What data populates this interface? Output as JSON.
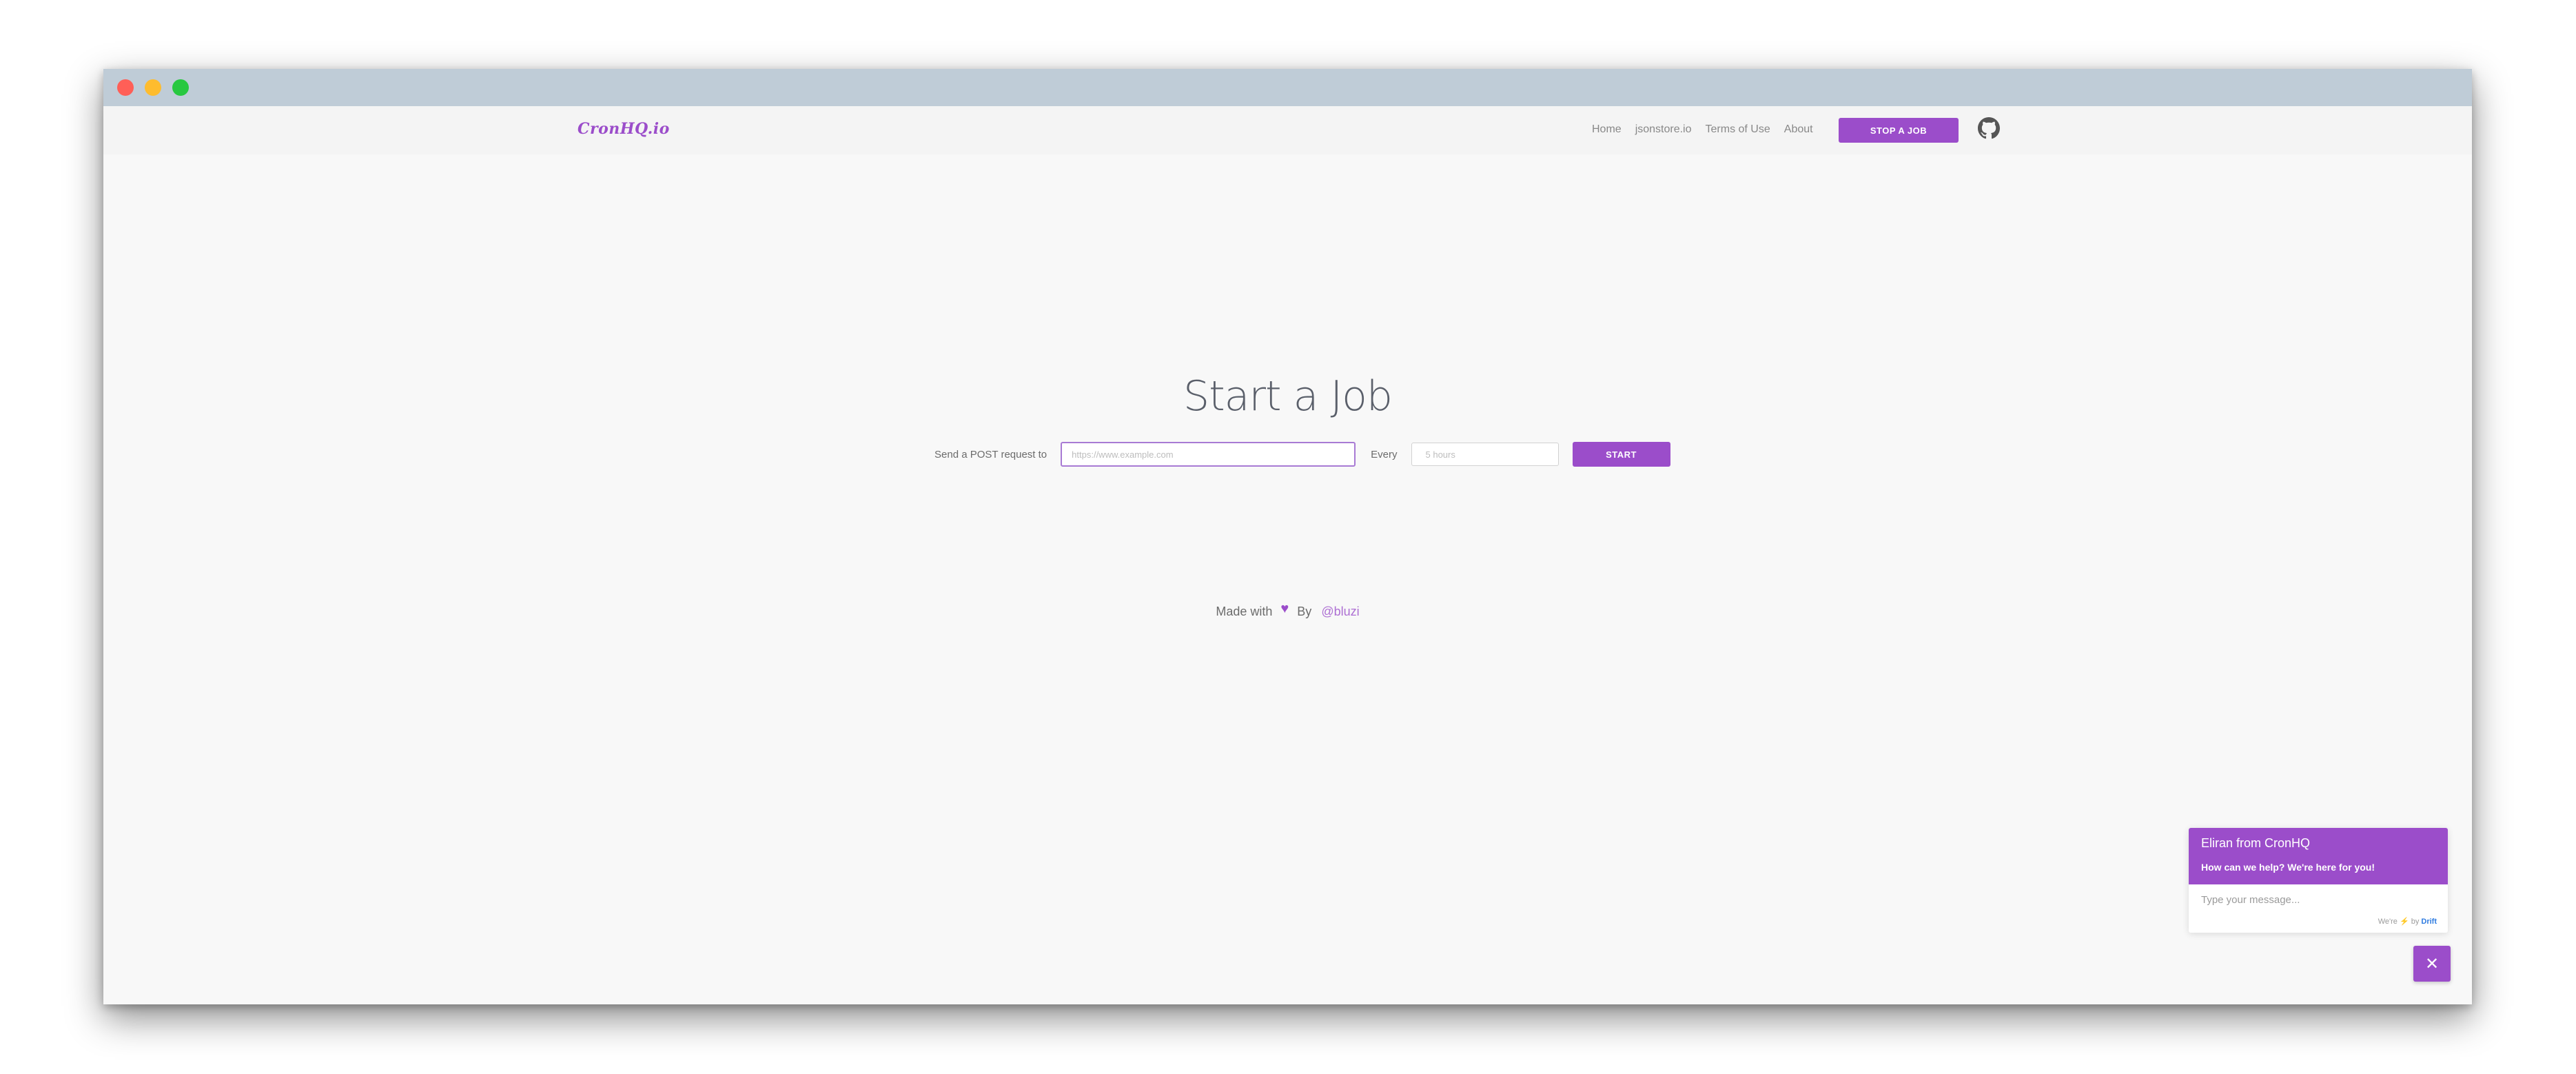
{
  "app": {
    "brand": "CronHQ.io"
  },
  "nav": {
    "links": [
      "Home",
      "jsonstore.io",
      "Terms of Use",
      "About"
    ],
    "stop_button": "STOP A JOB",
    "github_icon": "github-icon"
  },
  "main": {
    "title": "Start a Job",
    "send_label": "Send a POST request to",
    "url_placeholder": "https://www.example.com",
    "every_label": "Every",
    "interval_placeholder": "5 hours",
    "start_button": "START"
  },
  "footer": {
    "made_with": "Made with",
    "heart_icon": "heart-icon",
    "by": "By",
    "handle": "@bluzi"
  },
  "chat": {
    "agent_name": "Eliran from CronHQ",
    "greeting": "How can we help? We're here for you!",
    "input_placeholder": "Type your message...",
    "powered_prefix": "We're",
    "powered_by": "by",
    "powered_brand": "Drift",
    "close_icon": "close-icon"
  },
  "colors": {
    "accent": "#9b4dca",
    "titlebar": "#bfccd7",
    "background": "#f8f8f8"
  }
}
